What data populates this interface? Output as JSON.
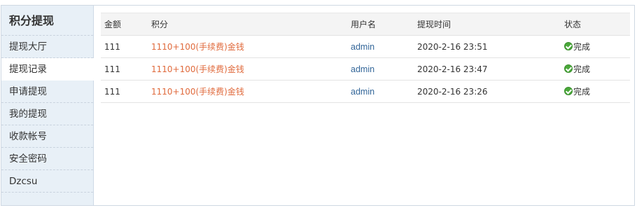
{
  "sidebar": {
    "title": "积分提现",
    "items": [
      {
        "label": "提现大厅",
        "active": false
      },
      {
        "label": "提现记录",
        "active": true
      },
      {
        "label": "申请提现",
        "active": false
      },
      {
        "label": "我的提现",
        "active": false
      },
      {
        "label": "收款帐号",
        "active": false
      },
      {
        "label": "安全密码",
        "active": false
      },
      {
        "label": "Dzcsu",
        "active": false
      }
    ]
  },
  "table": {
    "headers": {
      "amount": "金额",
      "points": "积分",
      "user": "用户名",
      "time": "提现时间",
      "status": "状态"
    },
    "rows": [
      {
        "amount": "111",
        "points": "1110+100(手续费)金钱",
        "user": "admin",
        "time": "2020-2-16 23:51",
        "status": "完成"
      },
      {
        "amount": "111",
        "points": "1110+100(手续费)金钱",
        "user": "admin",
        "time": "2020-2-16 23:47",
        "status": "完成"
      },
      {
        "amount": "111",
        "points": "1110+100(手续费)金钱",
        "user": "admin",
        "time": "2020-2-16 23:26",
        "status": "完成"
      }
    ]
  },
  "colors": {
    "sidebar_bg": "#e8f0f7",
    "points_text": "#e06a3c",
    "user_text": "#336699",
    "status_ok": "#4aa83a"
  },
  "icons": {
    "status_ok": "check-circle-icon"
  }
}
